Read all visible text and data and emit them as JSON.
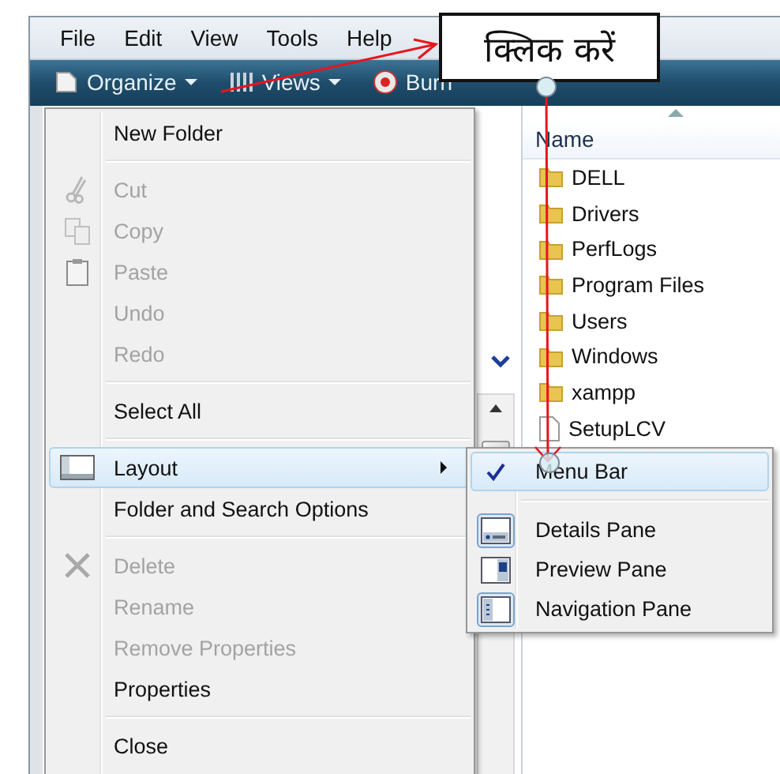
{
  "menu_bar": [
    {
      "label": "File"
    },
    {
      "label": "Edit"
    },
    {
      "label": "View"
    },
    {
      "label": "Tools"
    },
    {
      "label": "Help"
    }
  ],
  "toolbar": [
    {
      "label": "Organize",
      "kind": "dropdown"
    },
    {
      "label": "Views",
      "kind": "dropdown"
    },
    {
      "label": "Burn",
      "kind": "button"
    }
  ],
  "context_menu": [
    {
      "kind": "item",
      "label": "New Folder",
      "disabled": false,
      "selected": false
    },
    {
      "kind": "separator"
    },
    {
      "kind": "item",
      "label": "Cut",
      "disabled": true,
      "selected": false
    },
    {
      "kind": "item",
      "label": "Copy",
      "disabled": true,
      "selected": false
    },
    {
      "kind": "item",
      "label": "Paste",
      "disabled": true,
      "selected": false
    },
    {
      "kind": "item",
      "label": "Undo",
      "disabled": true,
      "selected": false
    },
    {
      "kind": "item",
      "label": "Redo",
      "disabled": true,
      "selected": false
    },
    {
      "kind": "separator"
    },
    {
      "kind": "item",
      "label": "Select All",
      "disabled": false,
      "selected": false
    },
    {
      "kind": "separator"
    },
    {
      "kind": "submenu",
      "label": "Layout",
      "disabled": false,
      "selected": true
    },
    {
      "kind": "item",
      "label": "Folder and Search Options",
      "disabled": false,
      "selected": false
    },
    {
      "kind": "separator"
    },
    {
      "kind": "item",
      "label": "Delete",
      "disabled": true,
      "selected": false
    },
    {
      "kind": "item",
      "label": "Rename",
      "disabled": true,
      "selected": false
    },
    {
      "kind": "item",
      "label": "Remove Properties",
      "disabled": true,
      "selected": false
    },
    {
      "kind": "item",
      "label": "Properties",
      "disabled": false,
      "selected": false
    },
    {
      "kind": "separator"
    },
    {
      "kind": "item",
      "label": "Close",
      "disabled": false,
      "selected": false
    }
  ],
  "layout_submenu": [
    {
      "kind": "check",
      "label": "Menu Bar",
      "checked": true,
      "selected": true
    },
    {
      "kind": "separator"
    },
    {
      "kind": "pane",
      "label": "Details Pane",
      "checked": true,
      "selected": false
    },
    {
      "kind": "pane",
      "label": "Preview Pane",
      "checked": false,
      "selected": false
    },
    {
      "kind": "pane",
      "label": "Navigation Pane",
      "checked": true,
      "selected": false
    }
  ],
  "file_list": {
    "column": "Name",
    "files": [
      {
        "name": "DELL",
        "kind": "folder"
      },
      {
        "name": "Drivers",
        "kind": "folder"
      },
      {
        "name": "PerfLogs",
        "kind": "folder"
      },
      {
        "name": "Program Files",
        "kind": "folder"
      },
      {
        "name": "Users",
        "kind": "folder"
      },
      {
        "name": "Windows",
        "kind": "folder"
      },
      {
        "name": "xampp",
        "kind": "folder"
      },
      {
        "name": "SetupLCV",
        "kind": "file"
      }
    ]
  },
  "callout": {
    "text": "क्लिक करें"
  }
}
